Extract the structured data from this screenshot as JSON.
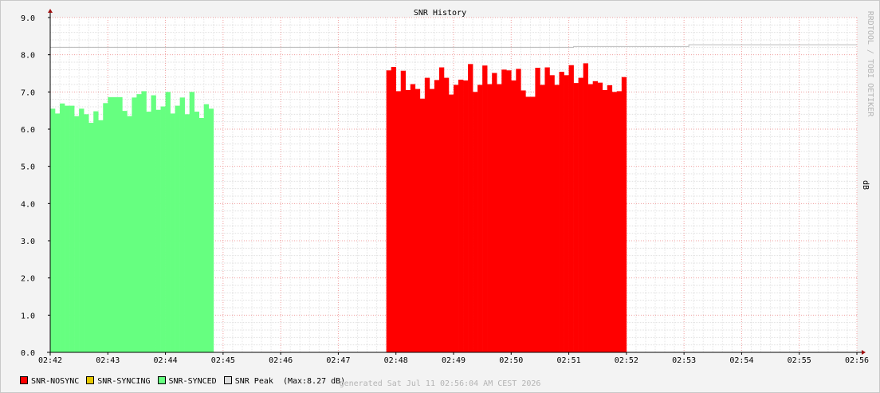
{
  "chart_data": {
    "type": "area",
    "title": "SNR History",
    "ylabel": "dB",
    "watermark": "RRDTOOL / TOBI OETIKER",
    "ylim": [
      0,
      9
    ],
    "yticks": [
      "0.0",
      "1.0",
      "2.0",
      "3.0",
      "4.0",
      "5.0",
      "6.0",
      "7.0",
      "8.0",
      "9.0"
    ],
    "xticks": [
      "02:42",
      "02:43",
      "02:44",
      "02:45",
      "02:46",
      "02:47",
      "02:48",
      "02:49",
      "02:50",
      "02:51",
      "02:52",
      "02:53",
      "02:54",
      "02:55",
      "02:56"
    ],
    "grid": true,
    "legend_position": "bottom",
    "series": [
      {
        "name": "SNR-SYNCED",
        "color": "#66ff80",
        "x_start": "02:42",
        "x_step_seconds": 5,
        "values": [
          6.55,
          6.42,
          6.69,
          6.63,
          6.63,
          6.35,
          6.55,
          6.4,
          6.17,
          6.48,
          6.24,
          6.7,
          6.86,
          6.86,
          6.86,
          6.49,
          6.35,
          6.85,
          6.94,
          7.02,
          6.47,
          6.91,
          6.52,
          6.61,
          7.0,
          6.42,
          6.63,
          6.85,
          6.4,
          7.0,
          6.47,
          6.3,
          6.67,
          6.55
        ]
      },
      {
        "name": "SNR-NOSYNC",
        "color": "#ff0000",
        "x_start": "02:47:50",
        "x_step_seconds": 5,
        "values": [
          7.58,
          7.67,
          7.02,
          7.57,
          7.05,
          7.21,
          7.08,
          6.82,
          7.38,
          7.08,
          7.32,
          7.66,
          7.38,
          6.93,
          7.19,
          7.33,
          7.31,
          7.75,
          7.0,
          7.19,
          7.71,
          7.21,
          7.51,
          7.21,
          7.6,
          7.58,
          7.31,
          7.62,
          7.04,
          6.87,
          6.87,
          7.65,
          7.19,
          7.66,
          7.45,
          7.19,
          7.54,
          7.45,
          7.72,
          7.24,
          7.38,
          7.77,
          7.21,
          7.29,
          7.25,
          7.05,
          7.18,
          7.0,
          7.02,
          7.4
        ]
      },
      {
        "name": "SNR-SYNCING",
        "color": "#e6c800",
        "values": []
      },
      {
        "name": "SNR Peak",
        "color": "#bbbbbb",
        "line_points": [
          [
            "02:42",
            8.2
          ],
          [
            "02:51",
            8.2
          ],
          [
            "02:51:05",
            8.22
          ],
          [
            "02:53",
            8.22
          ],
          [
            "02:53:05",
            8.27
          ],
          [
            "02:56",
            8.27
          ]
        ]
      }
    ]
  },
  "legend": [
    {
      "label": "SNR-NOSYNC",
      "color": "#ff0000"
    },
    {
      "label": "SNR-SYNCING",
      "color": "#e6c800"
    },
    {
      "label": "SNR-SYNCED",
      "color": "#66ff80"
    },
    {
      "label": "SNR Peak",
      "color": "#dddddd",
      "extra": "(Max:8.27 dB)"
    }
  ],
  "footer": "generated Sat Jul 11 02:56:04 AM CEST 2026"
}
